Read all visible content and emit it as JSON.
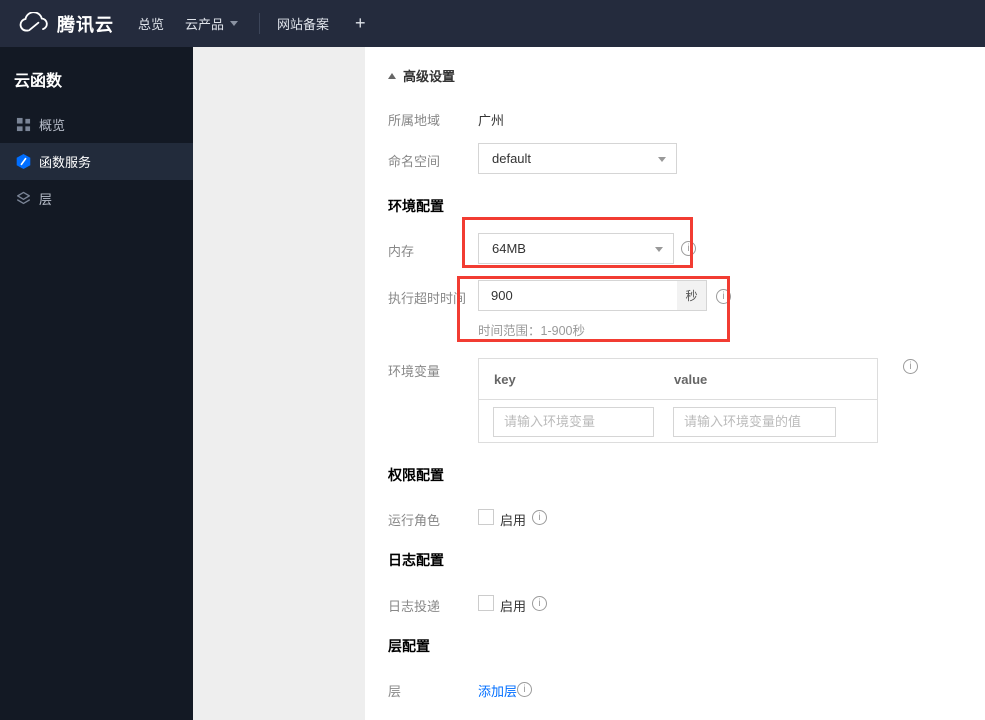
{
  "topbar": {
    "brand": "腾讯云",
    "nav_overview": "总览",
    "nav_products": "云产品",
    "nav_icp": "网站备案",
    "plus": "+"
  },
  "sidebar": {
    "title": "云函数",
    "items": [
      {
        "label": "概览",
        "icon": "grid-icon"
      },
      {
        "label": "函数服务",
        "icon": "function-hexagon-icon"
      },
      {
        "label": "层",
        "icon": "layers-icon"
      }
    ]
  },
  "content": {
    "advanced_settings_label": "高级设置",
    "region": {
      "label": "所属地域",
      "value": "广州"
    },
    "namespace": {
      "label": "命名空间",
      "value": "default"
    },
    "env_section": "环境配置",
    "memory": {
      "label": "内存",
      "value": "64MB"
    },
    "timeout": {
      "label": "执行超时时间",
      "value": "900",
      "unit": "秒",
      "hint": "时间范围：1-900秒"
    },
    "env_vars": {
      "label": "环境变量",
      "key_header": "key",
      "value_header": "value",
      "key_placeholder": "请输入环境变量",
      "value_placeholder": "请输入环境变量的值"
    },
    "perm_section": "权限配置",
    "run_role": {
      "label": "运行角色",
      "enable_label": "启用"
    },
    "log_section": "日志配置",
    "log_delivery": {
      "label": "日志投递",
      "enable_label": "启用"
    },
    "layer_section": "层配置",
    "layer": {
      "label": "层",
      "add_link": "添加层"
    }
  },
  "colors": {
    "accent_blue": "#006eff",
    "highlight_red": "#f23c32",
    "topbar_bg": "#242b3d",
    "sidebar_bg": "#131924"
  }
}
